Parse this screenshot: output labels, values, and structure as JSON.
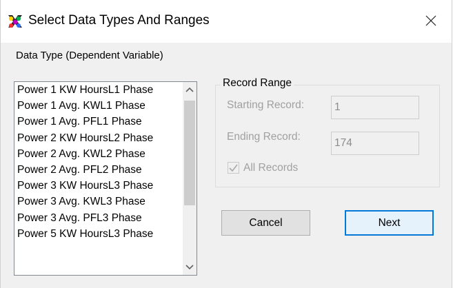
{
  "window": {
    "title": "Select Data Types And Ranges",
    "icon": "app-icon",
    "close_icon": "close-icon"
  },
  "data_type": {
    "label": "Data Type (Dependent Variable)",
    "items": [
      "Power 1 KW HoursL1 Phase",
      "Power 1 Avg. KWL1 Phase",
      "Power 1 Avg. PFL1 Phase",
      "Power 2 KW HoursL2 Phase",
      "Power 2 Avg. KWL2 Phase",
      "Power 2 Avg. PFL2 Phase",
      "Power 3 KW HoursL3 Phase",
      "Power 3 Avg. KWL3 Phase",
      "Power 3 Avg. PFL3 Phase",
      "Power 5 KW HoursL3 Phase"
    ]
  },
  "record_range": {
    "title": "Record Range",
    "starting_label": "Starting Record:",
    "starting_value": "1",
    "ending_label": "Ending Record:",
    "ending_value": "174",
    "all_records_label": "All Records",
    "all_records_checked": true
  },
  "buttons": {
    "cancel": "Cancel",
    "next": "Next"
  },
  "colors": {
    "focus_border": "#0078d7",
    "disabled_text": "#a0a0a0"
  }
}
